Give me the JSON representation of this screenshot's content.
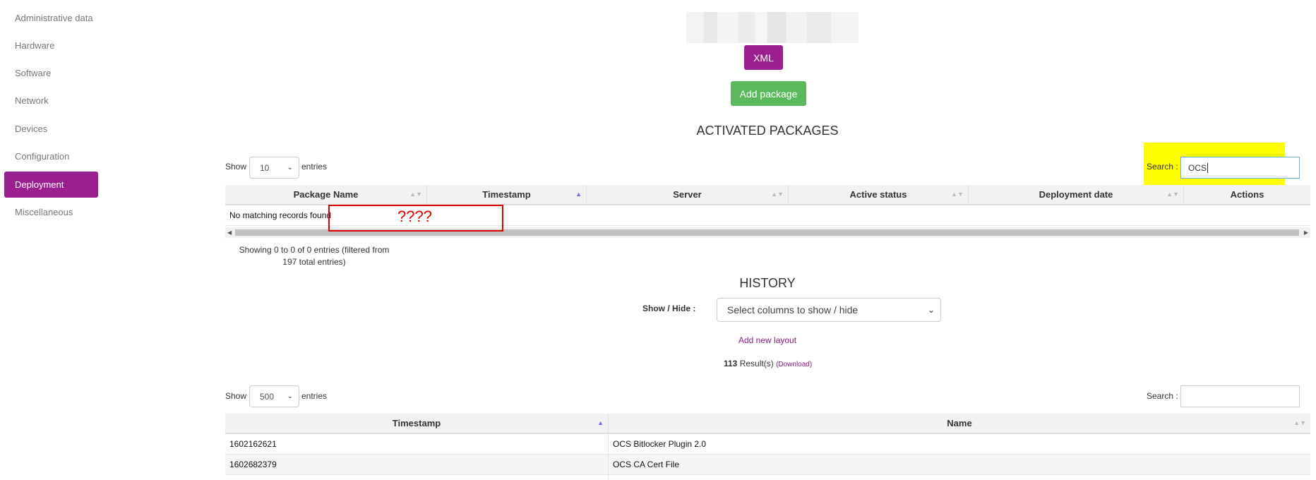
{
  "sidebar": {
    "items": [
      {
        "label": "Administrative data",
        "active": false
      },
      {
        "label": "Hardware",
        "active": false
      },
      {
        "label": "Software",
        "active": false
      },
      {
        "label": "Network",
        "active": false
      },
      {
        "label": "Devices",
        "active": false
      },
      {
        "label": "Configuration",
        "active": false
      },
      {
        "label": "Deployment",
        "active": true
      },
      {
        "label": "Miscellaneous",
        "active": false
      }
    ]
  },
  "header": {
    "xml_button": "XML",
    "add_package_button": "Add package"
  },
  "activated": {
    "title": "ACTIVATED PACKAGES",
    "show_label": "Show",
    "entries_value": "10",
    "entries_label": "entries",
    "search_label": "Search :",
    "search_value": "OCS",
    "columns": [
      "Package Name",
      "Timestamp",
      "Server",
      "Active status",
      "Deployment date",
      "Actions"
    ],
    "empty_message": "No matching records found",
    "info_line1": "Showing 0 to 0 of 0 entries (filtered from",
    "info_line2": "197 total entries)"
  },
  "annotation": {
    "text": "????"
  },
  "history": {
    "title": "HISTORY",
    "show_hide_label": "Show / Hide :",
    "show_hide_placeholder": "Select columns to show / hide",
    "add_layout_link": "Add new layout",
    "result_count": "113",
    "result_label": "Result(s)",
    "download_link": "(Download)",
    "show_label": "Show",
    "entries_value": "500",
    "entries_label": "entries",
    "search_label": "Search :",
    "search_value": "",
    "columns": [
      "Timestamp",
      "Name"
    ],
    "rows": [
      {
        "timestamp": "1602162621",
        "name": "OCS Bitlocker Plugin 2.0"
      },
      {
        "timestamp": "1602682379",
        "name": "OCS CA Cert File"
      }
    ]
  },
  "colors": {
    "accent": "#9b1f8e",
    "success": "#5cb85c",
    "highlight": "#ffff00",
    "annotation": "#e00000"
  }
}
